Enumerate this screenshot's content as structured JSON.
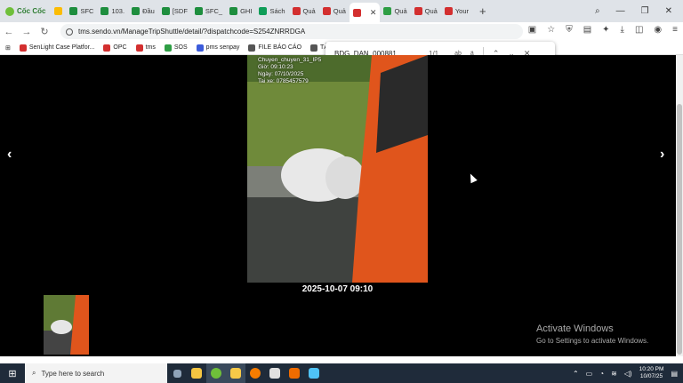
{
  "browser": {
    "brand": "Cốc Cốc",
    "tabs": [
      {
        "label": "SFC",
        "color": "#1e8e3e"
      },
      {
        "label": "103.",
        "color": "#1e8e3e"
      },
      {
        "label": "Đầu",
        "color": "#1e8e3e"
      },
      {
        "label": "[SDF",
        "color": "#1e8e3e"
      },
      {
        "label": "SFC_",
        "color": "#1e8e3e"
      },
      {
        "label": "GHI",
        "color": "#1e8e3e"
      },
      {
        "label": "Sách",
        "color": "#0f9d58"
      },
      {
        "label": "Quả",
        "color": "#d32f2f"
      },
      {
        "label": "Quả",
        "color": "#d32f2f"
      },
      {
        "label": "",
        "color": "#d32f2f"
      },
      {
        "label": "Quả",
        "color": "#2e9e44"
      },
      {
        "label": "Quả",
        "color": "#d32f2f"
      },
      {
        "label": "Your",
        "color": "#d32f2f"
      }
    ],
    "url": "tms.sendo.vn/ManageTripShuttle/detail/?dispatchcode=S254ZNRRDGA",
    "bookmarks": [
      {
        "label": "SenLight Case Platfor...",
        "color": "#d32f2f"
      },
      {
        "label": "OPC",
        "color": "#d32f2f"
      },
      {
        "label": "tms",
        "color": "#d32f2f"
      },
      {
        "label": "SOS",
        "color": "#2e9e44"
      },
      {
        "label": "pms senpay",
        "color": "#3b5bdb"
      },
      {
        "label": "FILE BÁO CÁO",
        "color": "#555555"
      },
      {
        "label": "TÀI LIỆU",
        "color": "#555555"
      }
    ]
  },
  "find": {
    "query": "BDG_DAN_000881",
    "count": "1/1",
    "match_case": "ab"
  },
  "viewer": {
    "prev": "‹",
    "next": "›",
    "overlay_lines": [
      "Chuyen_chuyen_31_IP5",
      "Giờ: 09:10:23",
      "Ngày: 07/10/2025",
      "Tai xe: 0785457579"
    ],
    "caption": "2025-10-07 09:10"
  },
  "watermark": {
    "title": "Activate Windows",
    "subtitle": "Go to Settings to activate Windows."
  },
  "taskbar": {
    "search_placeholder": "Type here to search",
    "time": "10:20 PM",
    "date": "10/07/25"
  }
}
